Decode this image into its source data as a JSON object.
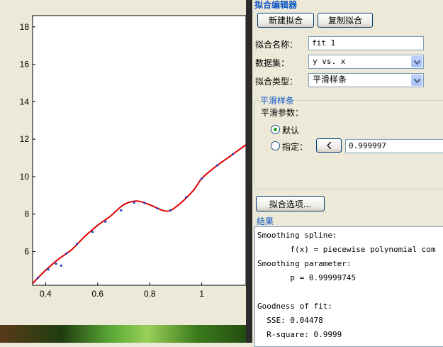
{
  "plot": {
    "x_ticks": [
      "0.4",
      "0.6",
      "0.8",
      "1"
    ],
    "y_ticks": [
      "6",
      "8",
      "10",
      "12",
      "14",
      "16",
      "18"
    ],
    "line_color": "#E00000",
    "marker_color": "#1F3FBF"
  },
  "chart_data": {
    "type": "line",
    "title": "",
    "xlabel": "",
    "ylabel": "",
    "xlim": [
      0.35,
      1.17
    ],
    "ylim": [
      4.2,
      18.6
    ],
    "grid": false,
    "series": [
      {
        "x": [
          0.35,
          0.4,
          0.45,
          0.5,
          0.55,
          0.6,
          0.65,
          0.7,
          0.75,
          0.8,
          0.85,
          0.88,
          0.92,
          0.97,
          1.0,
          1.05,
          1.1,
          1.15,
          1.17
        ],
        "y": [
          4.3,
          5.0,
          5.6,
          6.1,
          6.8,
          7.4,
          7.9,
          8.5,
          8.7,
          8.5,
          8.2,
          8.2,
          8.6,
          9.3,
          9.9,
          10.5,
          11.0,
          11.5,
          11.7
        ]
      }
    ],
    "points": [
      {
        "x": 0.37,
        "y": 4.6
      },
      {
        "x": 0.41,
        "y": 5.05
      },
      {
        "x": 0.44,
        "y": 5.35
      },
      {
        "x": 0.46,
        "y": 5.25
      },
      {
        "x": 0.48,
        "y": 5.9
      },
      {
        "x": 0.52,
        "y": 6.4
      },
      {
        "x": 0.58,
        "y": 7.05
      },
      {
        "x": 0.63,
        "y": 7.6
      },
      {
        "x": 0.69,
        "y": 8.2
      },
      {
        "x": 0.74,
        "y": 8.62
      },
      {
        "x": 0.78,
        "y": 8.6
      },
      {
        "x": 0.83,
        "y": 8.3
      },
      {
        "x": 0.88,
        "y": 8.2
      },
      {
        "x": 0.94,
        "y": 8.9
      },
      {
        "x": 1.0,
        "y": 9.9
      },
      {
        "x": 1.06,
        "y": 10.6
      },
      {
        "x": 1.12,
        "y": 11.2
      }
    ]
  },
  "editor": {
    "title": "拟合编辑器",
    "new_fit": "新建拟合",
    "copy_fit": "复制拟合",
    "fit_name_label": "拟合名称：",
    "fit_name_value": "fit 1",
    "dataset_label": "数据集：",
    "dataset_value": "y vs. x",
    "fit_type_label": "拟合类型：",
    "fit_type_value": "平滑样条",
    "smoothing": {
      "title": "平滑样条",
      "param_label": "平滑参数：",
      "default_label": "默认",
      "specify_label": "指定：",
      "value": "0.999997"
    },
    "options_button": "拟合选项...",
    "results_title": "结果",
    "results_lines": [
      "Smoothing spline:",
      "       f(x) = piecewise polynomial com",
      "Smoothing parameter:",
      "       p = 0.99999745",
      "",
      "Goodness of fit:",
      "  SSE: 0.04478",
      "  R-square: 0.9999"
    ]
  }
}
